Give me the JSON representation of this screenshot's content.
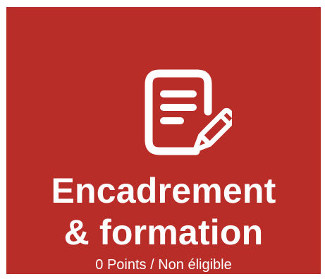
{
  "card": {
    "icon": "document-edit-icon",
    "title_line1": "Encadrement",
    "title_line2": "& formation",
    "subtitle": "0 Points / Non éligible",
    "background_color": "#b92d28",
    "text_color": "#ffffff"
  }
}
